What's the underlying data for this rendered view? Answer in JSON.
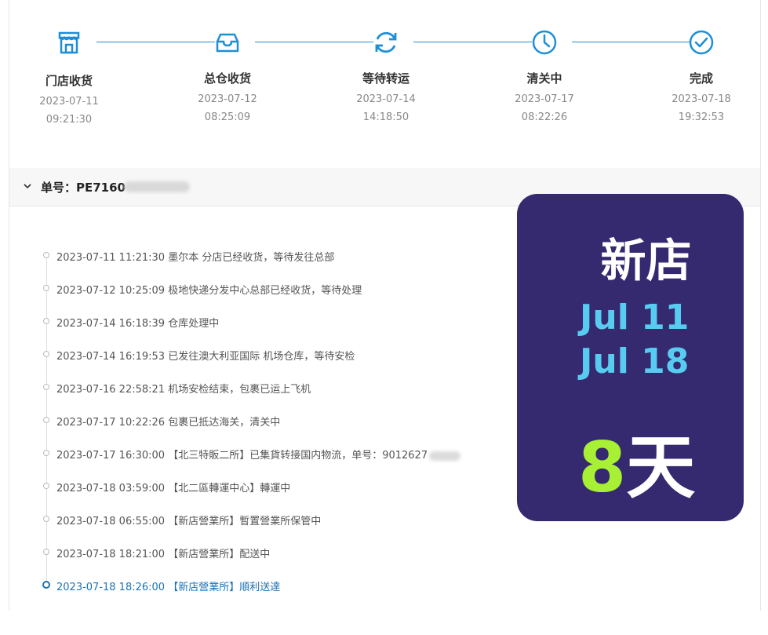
{
  "steps": [
    {
      "title": "门店收货",
      "date": "2023-07-11",
      "time": "09:21:30",
      "icon": "store-icon"
    },
    {
      "title": "总仓收货",
      "date": "2023-07-12",
      "time": "08:25:09",
      "icon": "inbox-icon"
    },
    {
      "title": "等待转运",
      "date": "2023-07-14",
      "time": "14:18:50",
      "icon": "refresh-icon"
    },
    {
      "title": "清关中",
      "date": "2023-07-17",
      "time": "08:22:26",
      "icon": "clock-icon"
    },
    {
      "title": "完成",
      "date": "2023-07-18",
      "time": "19:32:53",
      "icon": "check-circle-icon"
    }
  ],
  "order": {
    "label": "单号：PE7160"
  },
  "events": [
    {
      "text": "2023-07-11 11:21:30 墨尔本 分店已经收货，等待发往总部"
    },
    {
      "text": "2023-07-12 10:25:09 极地快递分发中心总部已经收货，等待处理"
    },
    {
      "text": "2023-07-14 16:18:39 仓库处理中"
    },
    {
      "text": "2023-07-14 16:19:53 已发往澳大利亚国际 机场仓库，等待安检"
    },
    {
      "text": "2023-07-16 22:58:21 机场安检结束，包裹已运上飞机"
    },
    {
      "text": "2023-07-17 10:22:26 包裹已抵达海关，清关中"
    },
    {
      "text": "2023-07-17 16:30:00 【北三特販二所】已集貨转接国内物流，单号：9012627"
    },
    {
      "text": "2023-07-18 03:59:00 【北二區轉運中心】轉運中"
    },
    {
      "text": "2023-07-18 06:55:00 【新店營業所】暫置營業所保管中"
    },
    {
      "text": "2023-07-18 18:21:00 【新店營業所】配送中"
    },
    {
      "text": "2023-07-18 18:26:00 【新店營業所】順利送達"
    }
  ],
  "overlay": {
    "store": "新店",
    "date_start": "Jul 11",
    "date_end": "Jul 18",
    "days_number": "8",
    "days_unit": "天"
  },
  "colors": {
    "accent": "#1d8fd6",
    "overlay_bg": "#35296f",
    "overlay_date": "#58ccf0",
    "overlay_number": "#a8f033",
    "active_event": "#1a73b8"
  }
}
